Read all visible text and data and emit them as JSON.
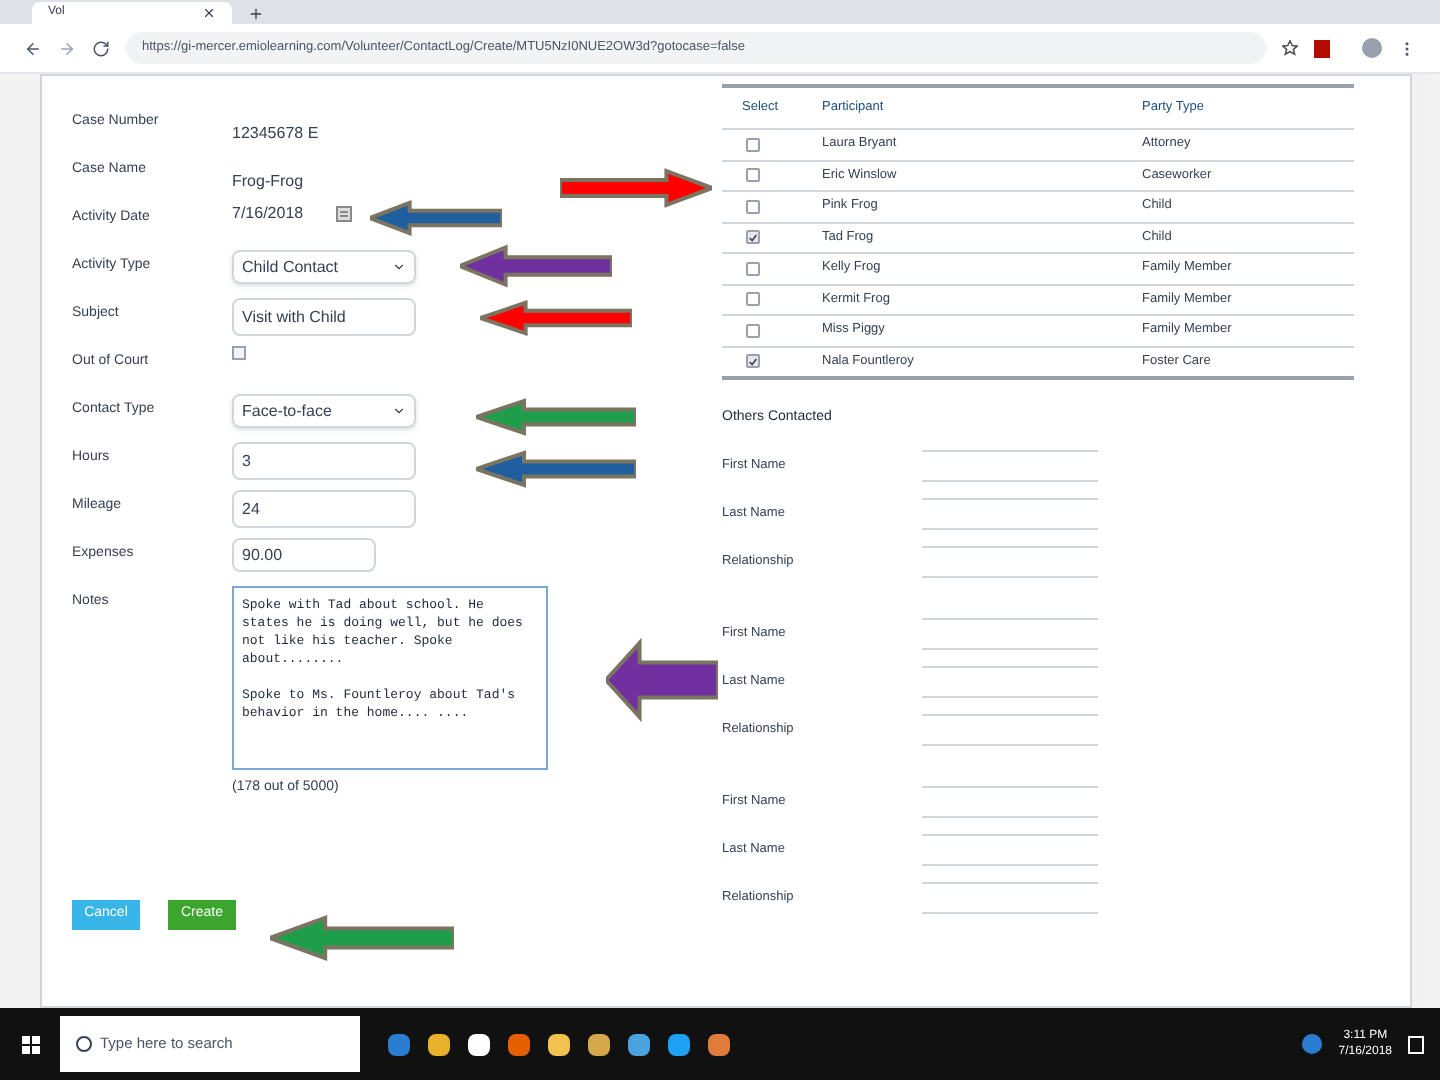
{
  "browser": {
    "tab_title": "Vol",
    "url": "https://gi-mercer.emiolearning.com/Volunteer/ContactLog/Create/MTU5NzI0NUE2OW3d?gotocase=false"
  },
  "form": {
    "fields": [
      {
        "kind": "text",
        "label": "Case Number",
        "value": "12345678 E"
      },
      {
        "kind": "text",
        "label": "Case Name",
        "value": "Frog-Frog"
      },
      {
        "kind": "date",
        "label": "Activity Date",
        "value": "7/16/2018"
      },
      {
        "kind": "select",
        "label": "Activity Type",
        "value": "Child Contact"
      },
      {
        "kind": "input",
        "label": "Subject",
        "value": "Visit with Child"
      },
      {
        "kind": "checkbox",
        "label": "Out of Court",
        "checked": false
      },
      {
        "kind": "select",
        "label": "Contact Type",
        "value": "Face-to-face"
      },
      {
        "kind": "input",
        "label": "Hours",
        "value": "3"
      },
      {
        "kind": "input",
        "label": "Mileage",
        "value": "24"
      },
      {
        "kind": "short",
        "label": "Expenses",
        "value": "90.00"
      },
      {
        "kind": "textarea",
        "label": "Notes",
        "value": "Spoke with Tad about school. He states he is doing well, but he does not like his teacher. Spoke about........\n\nSpoke to Ms. Fountleroy about Tad's behavior in the home.... ....",
        "counter": "(178 out of 5000)"
      }
    ],
    "buttons": [
      {
        "kind": "cancel",
        "label": "Cancel"
      },
      {
        "kind": "create",
        "label": "Create"
      }
    ]
  },
  "participants": {
    "columns": [
      "Select",
      "Participant",
      "Party Type"
    ],
    "rows": [
      {
        "name": "Laura Bryant",
        "party_type": "Attorney",
        "checked": false
      },
      {
        "name": "Eric Winslow",
        "party_type": "Caseworker",
        "checked": false
      },
      {
        "name": "Pink Frog",
        "party_type": "Child",
        "checked": false
      },
      {
        "name": "Tad Frog",
        "party_type": "Child",
        "checked": true
      },
      {
        "name": "Kelly Frog",
        "party_type": "Family Member",
        "checked": false
      },
      {
        "name": "Kermit Frog",
        "party_type": "Family Member",
        "checked": false
      },
      {
        "name": "Miss Piggy",
        "party_type": "Family Member",
        "checked": false
      },
      {
        "name": "Nala Fountleroy",
        "party_type": "Foster Care",
        "checked": true
      }
    ]
  },
  "others_contacted": {
    "title": "Others Contacted",
    "groups": [
      {
        "labels": [
          "First Name",
          "Last Name",
          "Relationship"
        ]
      },
      {
        "labels": [
          "First Name",
          "Last Name",
          "Relationship"
        ]
      },
      {
        "labels": [
          "First Name",
          "Last Name",
          "Relationship"
        ]
      }
    ]
  },
  "annotations": [
    {
      "points_right": true,
      "color": "#ff0000"
    },
    {
      "points_right": false,
      "color": "#1f5f9f"
    },
    {
      "points_right": false,
      "color": "#7030a0"
    },
    {
      "points_right": false,
      "color": "#ff0000"
    },
    {
      "points_right": false,
      "color": "#1e9e4a"
    },
    {
      "points_right": false,
      "color": "#1f5f9f"
    },
    {
      "points_right": false,
      "color": "#7030a0"
    },
    {
      "points_right": false,
      "color": "#1e9e4a"
    }
  ],
  "taskbar": {
    "search_placeholder": "Type here to search",
    "time": "3:11 PM",
    "date": "7/16/2018"
  }
}
